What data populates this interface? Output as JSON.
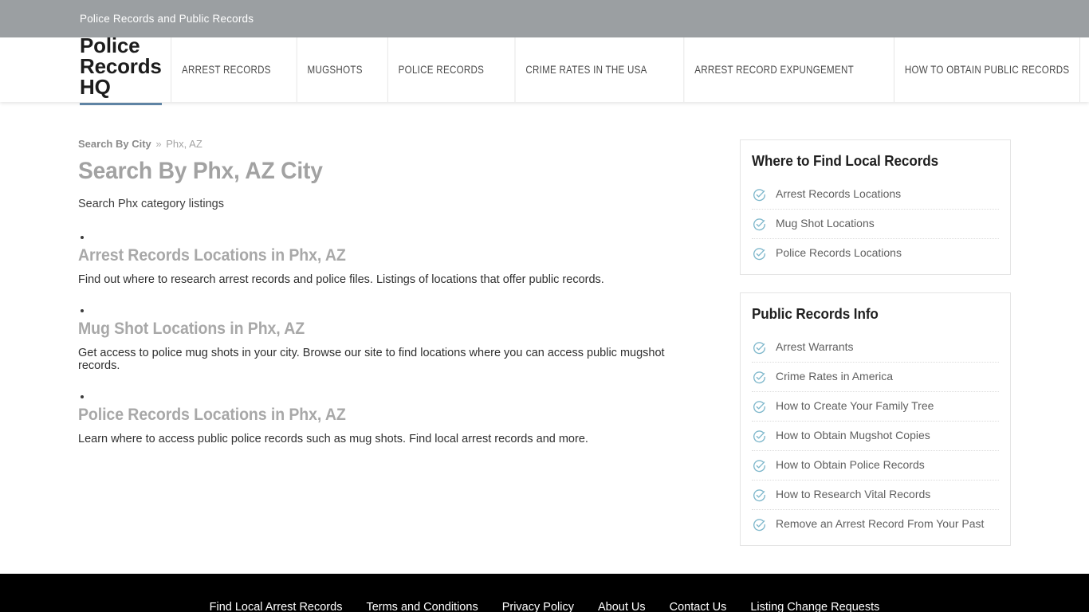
{
  "topbar": {
    "title": "Police Records and Public Records"
  },
  "header": {
    "logo": "Police Records HQ",
    "logo_underline_color": "#5f84a4",
    "nav": [
      {
        "label": "ARREST RECORDS"
      },
      {
        "label": "MUGSHOTS"
      },
      {
        "label": "POLICE RECORDS"
      },
      {
        "label": "CRIME RATES IN THE USA"
      },
      {
        "label": "ARREST RECORD EXPUNGEMENT"
      },
      {
        "label": "HOW TO OBTAIN PUBLIC RECORDS"
      }
    ]
  },
  "breadcrumb": {
    "parent": "Search By City",
    "separator": "»",
    "current": "Phx, AZ"
  },
  "main": {
    "title": "Search By Phx, AZ City",
    "intro": "Search Phx category listings",
    "listings": [
      {
        "title": "Arrest Records Locations in Phx, AZ",
        "desc": "Find out where to research arrest records and police files. Listings of locations that offer public records."
      },
      {
        "title": "Mug Shot Locations in Phx, AZ",
        "desc": "Get access to police mug shots in your city. Browse our site to find locations where you can access public mugshot records."
      },
      {
        "title": "Police Records Locations in Phx, AZ",
        "desc": "Learn where to access public police records such as mug shots. Find local arrest records and more."
      }
    ]
  },
  "sidebar": {
    "check_icon_color": "#7fb8cc",
    "widgets": [
      {
        "title": "Where to Find Local Records",
        "items": [
          {
            "label": "Arrest Records Locations",
            "icon": "check-circle-icon"
          },
          {
            "label": "Mug Shot Locations",
            "icon": "check-circle-icon"
          },
          {
            "label": "Police Records Locations",
            "icon": "check-circle-icon"
          }
        ]
      },
      {
        "title": "Public Records Info",
        "items": [
          {
            "label": "Arrest Warrants",
            "icon": "check-circle-icon"
          },
          {
            "label": "Crime Rates in America",
            "icon": "check-circle-icon"
          },
          {
            "label": "How to Create Your Family Tree",
            "icon": "check-circle-icon"
          },
          {
            "label": "How to Obtain Mugshot Copies",
            "icon": "check-circle-icon"
          },
          {
            "label": "How to Obtain Police Records",
            "icon": "check-circle-icon"
          },
          {
            "label": "How to Research Vital Records",
            "icon": "check-circle-icon"
          },
          {
            "label": "Remove an Arrest Record From Your Past",
            "icon": "check-circle-icon"
          }
        ]
      }
    ]
  },
  "footer": {
    "links": [
      {
        "label": "Find Local Arrest Records"
      },
      {
        "label": "Terms and Conditions"
      },
      {
        "label": "Privacy Policy"
      },
      {
        "label": "About Us"
      },
      {
        "label": "Contact Us"
      },
      {
        "label": "Listing Change Requests"
      }
    ]
  }
}
